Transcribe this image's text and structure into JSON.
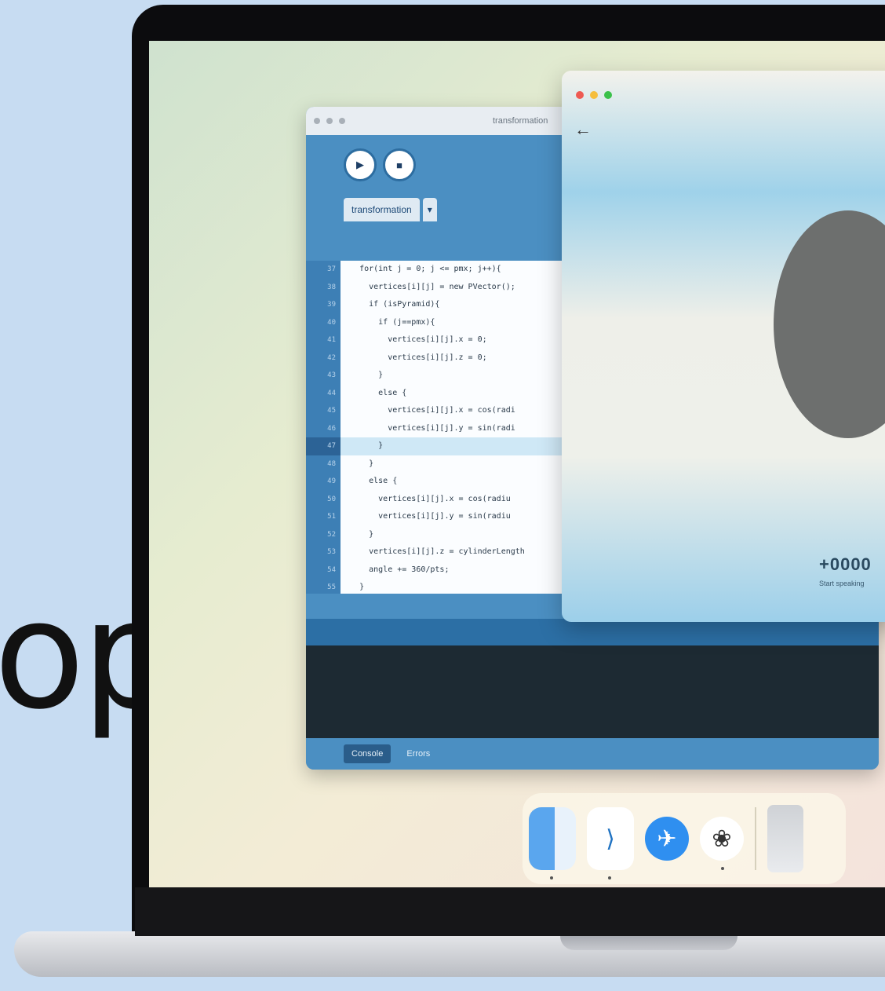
{
  "hero": {
    "word": "op"
  },
  "ide": {
    "window_title": "transformation",
    "tab_label": "transformation",
    "tab_more": "▾",
    "run_icon": "▶",
    "stop_icon": "■",
    "line_numbers": [
      "37",
      "38",
      "39",
      "40",
      "41",
      "42",
      "43",
      "44",
      "45",
      "46",
      "47",
      "48",
      "49",
      "50",
      "51",
      "52",
      "53",
      "54",
      "55"
    ],
    "code_lines": [
      "    for(int j = 0; j <= pmx; j++){",
      "      vertices[i][j] = new PVector();",
      "      if (isPyramid){",
      "        if (j==pmx){",
      "          vertices[i][j].x = 0;",
      "          vertices[i][j].z = 0;",
      "        }",
      "        else {",
      "          vertices[i][j].x = cos(radi",
      "          vertices[i][j].y = sin(radi",
      "        }",
      "      }",
      "      else {",
      "        vertices[i][j].x = cos(radiu",
      "        vertices[i][j].y = sin(radiu",
      "      }",
      "      vertices[i][j].z = cylinderLength",
      "      angle += 360/pts;",
      "    }"
    ],
    "status_console": "Console",
    "status_errors": "Errors"
  },
  "preview": {
    "count": "+0000",
    "subtext": "Start speaking"
  },
  "dock": {
    "apps": [
      {
        "name": "finder-icon",
        "glyph": ""
      },
      {
        "name": "vscode-icon",
        "glyph": "⟩"
      },
      {
        "name": "safari-icon",
        "glyph": "✈"
      },
      {
        "name": "chatgpt-icon",
        "glyph": "❀"
      }
    ]
  },
  "colors": {
    "ide_blue": "#4b8fc2",
    "traffic_red": "#ee5a52",
    "traffic_yellow": "#f5be3d",
    "traffic_green": "#3bc14a"
  }
}
